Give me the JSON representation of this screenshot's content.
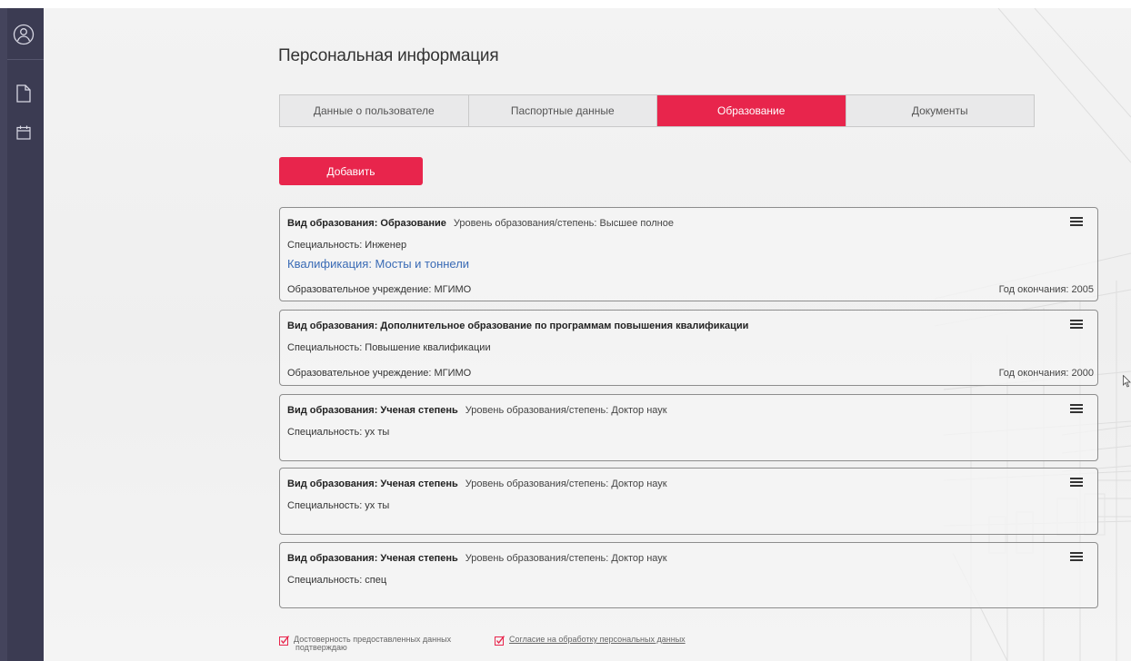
{
  "page": {
    "title": "Персональная информация"
  },
  "tabs": [
    {
      "label": "Данные о пользователе",
      "active": false
    },
    {
      "label": "Паспортные данные",
      "active": false
    },
    {
      "label": "Образование",
      "active": true
    },
    {
      "label": "Документы",
      "active": false
    }
  ],
  "add_button": "Добавить",
  "colors": {
    "accent": "#e8254c",
    "sidebar": "#3b3b52",
    "link": "#3a6bb5"
  },
  "sidebar": {
    "icons": [
      "user-circle-icon",
      "document-icon",
      "calendar-icon"
    ]
  },
  "cards": [
    {
      "type": "Вид образования: Образование",
      "level": "Уровень образования/степень: Высшее полное",
      "specialty": "Специальность: Инженер",
      "qualification": "Квалификация: Мосты и тоннели",
      "institution": "Образовательное учреждение: МГИМО",
      "year": "Год окончания: 2005"
    },
    {
      "type": "Вид образования: Дополнительное образование по программам повышения квалификации",
      "specialty": "Специальность: Повышение квалификации",
      "institution": "Образовательное учреждение: МГИМО",
      "year": "Год окончания: 2000"
    },
    {
      "type": "Вид образования: Ученая степень",
      "level": "Уровень образования/степень: Доктор наук",
      "specialty": "Специальность: ух ты"
    },
    {
      "type": "Вид образования: Ученая степень",
      "level": "Уровень образования/степень: Доктор наук",
      "specialty": "Специальность: ух ты"
    },
    {
      "type": "Вид образования: Ученая степень",
      "level": "Уровень образования/степень: Доктор наук",
      "specialty": "Специальность: спец"
    }
  ],
  "footer": {
    "confirm_line1": "Достоверность предоставленных данных",
    "confirm_line2": "подтверждаю",
    "consent_link": "Согласие на обработку персональных данных"
  }
}
